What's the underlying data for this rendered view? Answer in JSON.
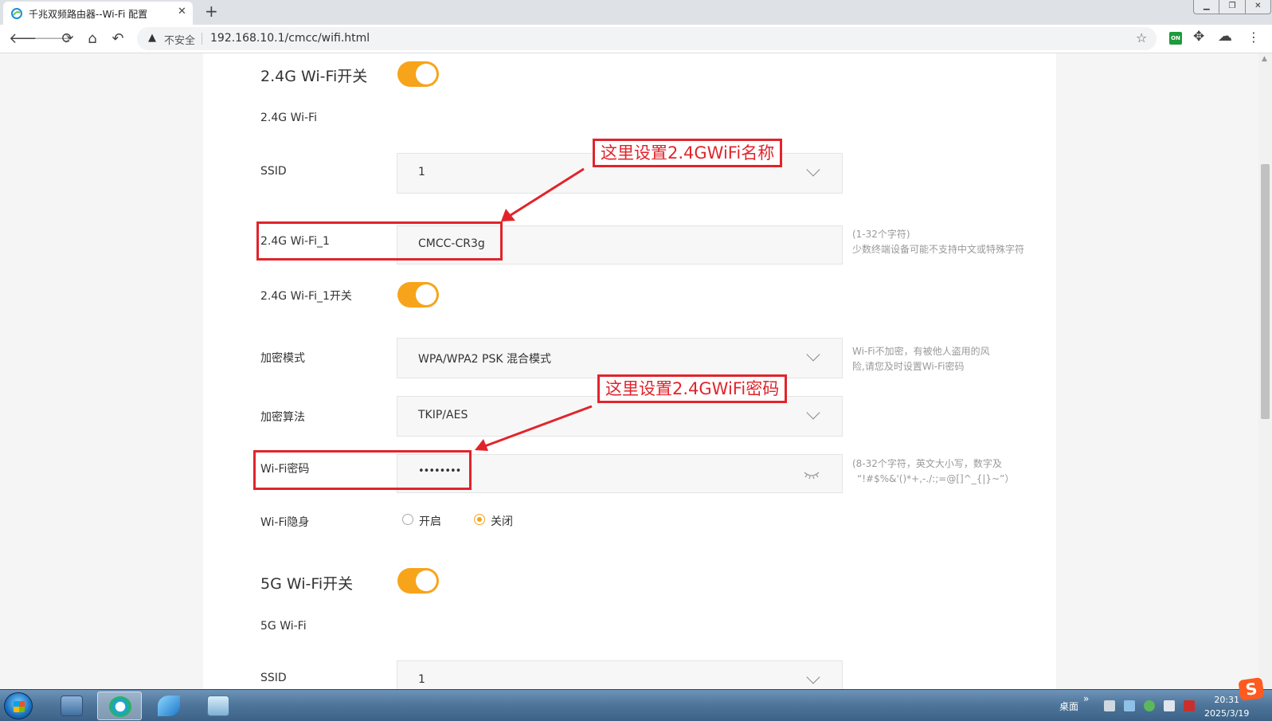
{
  "browser": {
    "tab_title": "千兆双频路由器--Wi-Fi 配置",
    "tab_close": "✕",
    "new_tab": "+",
    "insecure_label": "不安全",
    "url": "192.168.10.1/cmcc/wifi.html",
    "ext_on_label": "ON"
  },
  "page": {
    "wifi24_switch_title": "2.4G Wi-Fi开关",
    "wifi24_switch_on": true,
    "wifi24_heading": "2.4G Wi-Fi",
    "ssid_label": "SSID",
    "ssid_value": "1",
    "ssid_name_label": "2.4G Wi-Fi_1",
    "ssid_name_value": "CMCC-CR3g",
    "ssid_name_hint_1": "(1-32个字符)",
    "ssid_name_hint_2": "少数终端设备可能不支持中文或特殊字符",
    "ssid1_switch_label": "2.4G Wi-Fi_1开关",
    "ssid1_switch_on": true,
    "encrypt_mode_label": "加密模式",
    "encrypt_mode_value": "WPA/WPA2 PSK 混合模式",
    "encrypt_hint_1": "Wi-Fi不加密，有被他人盗用的风",
    "encrypt_hint_2": "险,请您及时设置Wi-Fi密码",
    "algorithm_label": "加密算法",
    "algorithm_value": "TKIP/AES",
    "password_label": "Wi-Fi密码",
    "password_value": "••••••••",
    "password_hint_1": "(8-32个字符，英文大小写，数字及",
    "password_hint_2": "“!#$%&'()*+,-./:;=@[]^_{|}~”）",
    "hidden_label": "Wi-Fi隐身",
    "hidden_option_on": "开启",
    "hidden_option_off": "关闭",
    "hidden_selected": "关闭",
    "wifi5_switch_title": "5G Wi-Fi开关",
    "wifi5_switch_on": true,
    "wifi5_heading": "5G Wi-Fi",
    "wifi5_ssid_label": "SSID",
    "wifi5_ssid_value": "1"
  },
  "annotations": {
    "name_note": "这里设置2.4GWiFi名称",
    "password_note": "这里设置2.4GWiFi密码",
    "color": "#e1242b"
  },
  "theme": {
    "accent": "#f7a41b"
  },
  "taskbar": {
    "desktop_label": "桌面",
    "time": "20:31",
    "date": "2025/3/19",
    "ime_logo": "S"
  }
}
